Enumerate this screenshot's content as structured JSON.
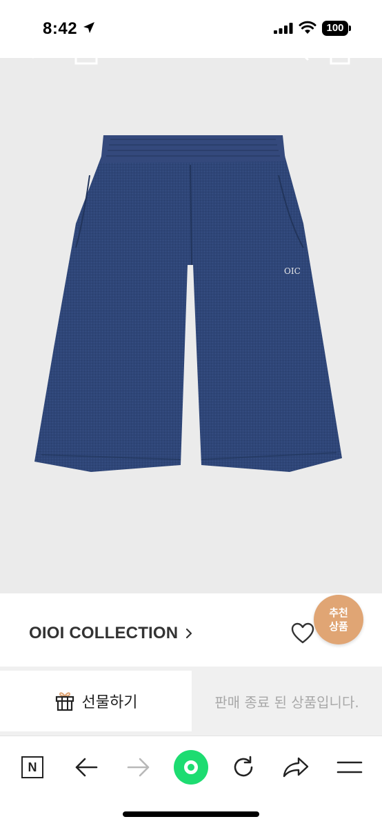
{
  "status_bar": {
    "time": "8:42",
    "battery": "100"
  },
  "product": {
    "image_alt": "denim shorts",
    "logo_text": "OIC"
  },
  "brand": {
    "name": "OIOI COLLECTION"
  },
  "badge": {
    "line1": "추천",
    "line2": "상품"
  },
  "actions": {
    "gift_label": "선물하기",
    "soldout_label": "판매 종료 된 상품입니다."
  },
  "colors": {
    "accent_green": "#1ddc71",
    "badge": "#e0a574",
    "denim": "#2e4577"
  }
}
